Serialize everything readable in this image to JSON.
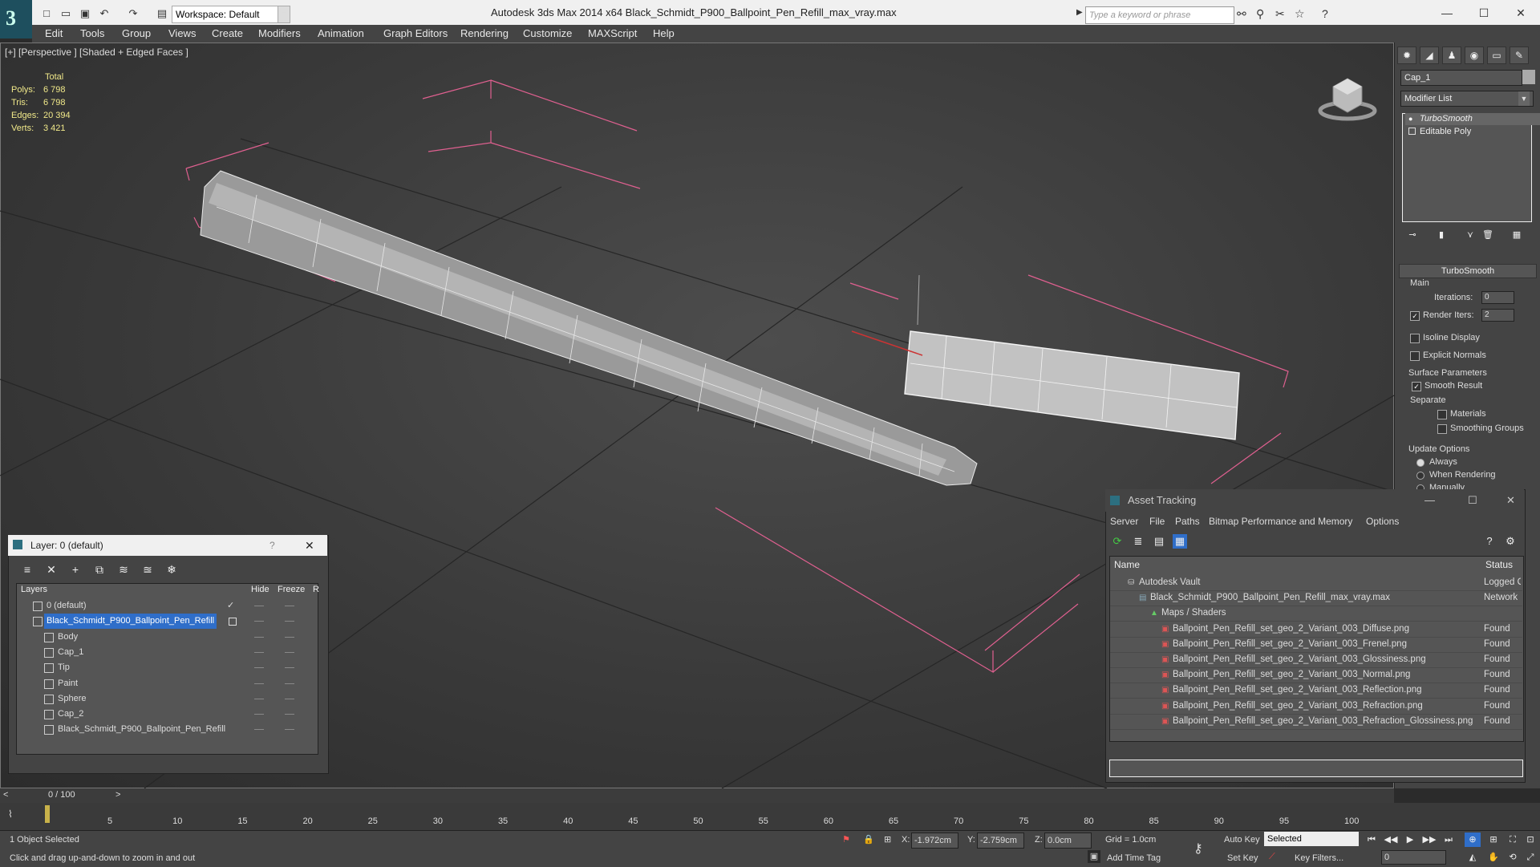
{
  "app": {
    "title": "Autodesk 3ds Max  2014 x64     Black_Schmidt_P900_Ballpoint_Pen_Refill_max_vray.max",
    "workspace": "Workspace: Default",
    "search_placeholder": "Type a keyword or phrase",
    "menus": [
      "Edit",
      "Tools",
      "Group",
      "Views",
      "Create",
      "Modifiers",
      "Animation",
      "Graph Editors",
      "Rendering",
      "Customize",
      "MAXScript",
      "Help"
    ]
  },
  "viewport": {
    "label": "[+] [Perspective ] [Shaded + Edged Faces ]",
    "stats": {
      "header": "Total",
      "rows": [
        {
          "label": "Polys:",
          "value": "6 798"
        },
        {
          "label": "Tris:",
          "value": "6 798"
        },
        {
          "label": "Edges:",
          "value": "20 394"
        },
        {
          "label": "Verts:",
          "value": "3 421"
        }
      ]
    }
  },
  "command_panel": {
    "object_name": "Cap_1",
    "modifier_list": "Modifier List",
    "stack": [
      "TurboSmooth",
      "Editable Poly"
    ],
    "rollout_title": "TurboSmooth",
    "main_label": "Main",
    "iterations_label": "Iterations:",
    "iterations_value": "0",
    "render_iters_label": "Render Iters:",
    "render_iters_value": "2",
    "isoline": "Isoline Display",
    "explicit_normals": "Explicit Normals",
    "surface_params": "Surface Parameters",
    "smooth_result": "Smooth Result",
    "separate": "Separate",
    "materials": "Materials",
    "smoothing_groups": "Smoothing Groups",
    "update_options": "Update Options",
    "always": "Always",
    "when_rendering": "When Rendering",
    "manually": "Manually"
  },
  "layer_explorer": {
    "title": "Layer: 0 (default)",
    "help": "?",
    "columns": [
      "Layers",
      "Hide",
      "Freeze",
      "R"
    ],
    "rows": [
      {
        "name": "0 (default)",
        "indent": 1,
        "selected": false
      },
      {
        "name": "Black_Schmidt_P900_Ballpoint_Pen_Refill",
        "indent": 1,
        "selected": true
      },
      {
        "name": "Body",
        "indent": 2,
        "selected": false
      },
      {
        "name": "Cap_1",
        "indent": 2,
        "selected": false
      },
      {
        "name": "Tip",
        "indent": 2,
        "selected": false
      },
      {
        "name": "Paint",
        "indent": 2,
        "selected": false
      },
      {
        "name": "Sphere",
        "indent": 2,
        "selected": false
      },
      {
        "name": "Cap_2",
        "indent": 2,
        "selected": false
      },
      {
        "name": "Black_Schmidt_P900_Ballpoint_Pen_Refill",
        "indent": 2,
        "selected": false
      }
    ]
  },
  "asset_tracking": {
    "title": "Asset Tracking",
    "menus": [
      "Server",
      "File",
      "Paths",
      "Bitmap Performance and Memory",
      "Options"
    ],
    "columns": [
      "Name",
      "Status"
    ],
    "rows": [
      {
        "name": "Autodesk Vault",
        "status": "Logged Out",
        "indent": 1
      },
      {
        "name": "Black_Schmidt_P900_Ballpoint_Pen_Refill_max_vray.max",
        "status": "Network",
        "indent": 2
      },
      {
        "name": "Maps / Shaders",
        "status": "",
        "indent": 3
      },
      {
        "name": "Ballpoint_Pen_Refill_set_geo_2_Variant_003_Diffuse.png",
        "status": "Found",
        "indent": 4
      },
      {
        "name": "Ballpoint_Pen_Refill_set_geo_2_Variant_003_Frenel.png",
        "status": "Found",
        "indent": 4
      },
      {
        "name": "Ballpoint_Pen_Refill_set_geo_2_Variant_003_Glossiness.png",
        "status": "Found",
        "indent": 4
      },
      {
        "name": "Ballpoint_Pen_Refill_set_geo_2_Variant_003_Normal.png",
        "status": "Found",
        "indent": 4
      },
      {
        "name": "Ballpoint_Pen_Refill_set_geo_2_Variant_003_Reflection.png",
        "status": "Found",
        "indent": 4
      },
      {
        "name": "Ballpoint_Pen_Refill_set_geo_2_Variant_003_Refraction.png",
        "status": "Found",
        "indent": 4
      },
      {
        "name": "Ballpoint_Pen_Refill_set_geo_2_Variant_003_Refraction_Glossiness.png",
        "status": "Found",
        "indent": 4
      }
    ]
  },
  "timeline": {
    "frame": "0 / 100",
    "ticks": [
      "5",
      "10",
      "15",
      "20",
      "25",
      "30",
      "35",
      "40",
      "45",
      "50",
      "55",
      "60",
      "65",
      "70",
      "75",
      "80",
      "85",
      "90",
      "95",
      "100"
    ]
  },
  "status": {
    "selected": "1 Object Selected",
    "prompt": "Click and drag up-and-down to zoom in and out",
    "x_label": "X:",
    "x": "-1.972cm",
    "y_label": "Y:",
    "y": "-2.759cm",
    "z_label": "Z:",
    "z": "0.0cm",
    "grid": "Grid = 1.0cm",
    "auto_key": "Auto Key",
    "set_key": "Set Key",
    "selected_set": "Selected",
    "key_filters": "Key Filters...",
    "add_time_tag": "Add Time Tag",
    "frame_field": "0"
  }
}
